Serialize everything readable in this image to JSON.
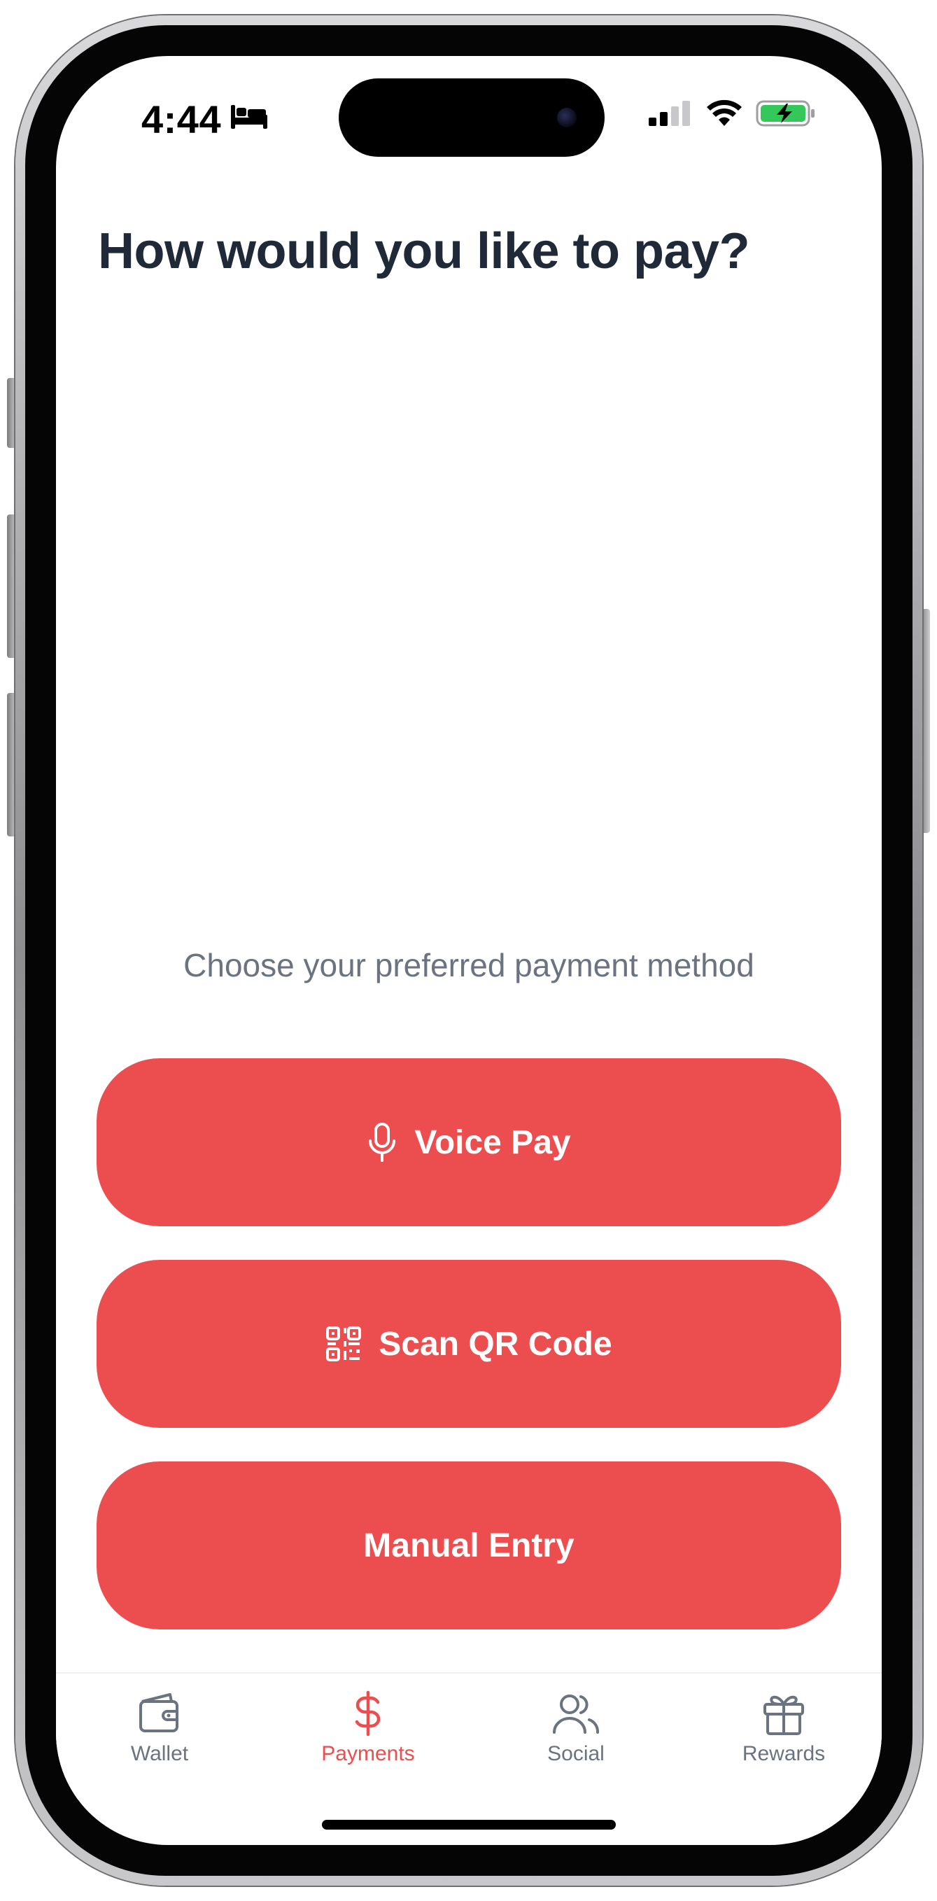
{
  "status_bar": {
    "time": "4:44",
    "icons": [
      "bed-icon",
      "signal-icon",
      "wifi-icon",
      "battery-charging-icon"
    ]
  },
  "header": {
    "title": "How would you like to pay?"
  },
  "main": {
    "subtitle": "Choose your preferred payment method",
    "buttons": [
      {
        "label": "Voice Pay",
        "icon": "microphone-icon"
      },
      {
        "label": "Scan QR Code",
        "icon": "qr-code-icon"
      },
      {
        "label": "Manual Entry",
        "icon": ""
      }
    ]
  },
  "tabbar": {
    "active_tab": "Payments",
    "items": [
      {
        "label": "Wallet",
        "icon": "wallet-icon"
      },
      {
        "label": "Payments",
        "icon": "dollar-icon"
      },
      {
        "label": "Social",
        "icon": "users-icon"
      },
      {
        "label": "Rewards",
        "icon": "gift-icon"
      }
    ]
  },
  "colors": {
    "accent": "#ec4d4f",
    "title_text": "#1f2937",
    "muted_text": "#6b7280",
    "battery_green": "#34c759"
  }
}
